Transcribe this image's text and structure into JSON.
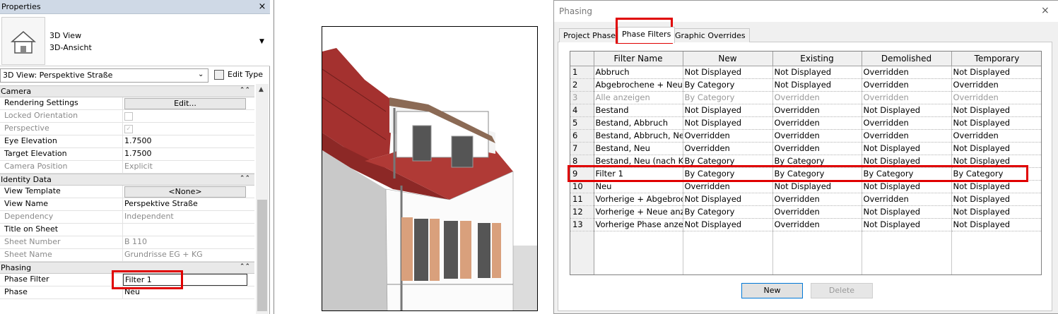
{
  "properties": {
    "title": "Properties",
    "close_icon": "×",
    "type_line1": "3D View",
    "type_line2": "3D-Ansicht",
    "instance_selector": "3D View: Perspektive Straße",
    "edit_type": "Edit Type",
    "groups": [
      {
        "name": "Camera",
        "rows": [
          {
            "name": "Rendering Settings",
            "value": "Edit...",
            "kind": "button"
          },
          {
            "name": "Locked Orientation",
            "value": "",
            "kind": "checkbox",
            "checked": false,
            "disabled": true
          },
          {
            "name": "Perspective",
            "value": "",
            "kind": "checkbox",
            "checked": true,
            "disabled": true
          },
          {
            "name": "Eye Elevation",
            "value": "1.7500"
          },
          {
            "name": "Target Elevation",
            "value": "1.7500"
          },
          {
            "name": "Camera Position",
            "value": "Explicit",
            "disabled": true
          }
        ]
      },
      {
        "name": "Identity Data",
        "rows": [
          {
            "name": "View Template",
            "value": "<None>",
            "kind": "button"
          },
          {
            "name": "View Name",
            "value": "Perspektive Straße"
          },
          {
            "name": "Dependency",
            "value": "Independent",
            "disabled": true
          },
          {
            "name": "Title on Sheet",
            "value": ""
          },
          {
            "name": "Sheet Number",
            "value": "B 110",
            "disabled": true
          },
          {
            "name": "Sheet Name",
            "value": "Grundrisse EG + KG",
            "disabled": true
          }
        ]
      },
      {
        "name": "Phasing",
        "rows": [
          {
            "name": "Phase Filter",
            "value": "Filter 1",
            "kind": "input"
          },
          {
            "name": "Phase",
            "value": "Neu"
          }
        ]
      }
    ]
  },
  "dialog": {
    "title": "Phasing",
    "close_icon": "×",
    "tabs": [
      "Project Phases",
      "Phase Filters",
      "Graphic Overrides"
    ],
    "active_tab": "Phase Filters",
    "columns": [
      "Filter Name",
      "New",
      "Existing",
      "Demolished",
      "Temporary"
    ],
    "rows": [
      {
        "num": "1",
        "name": "Abbruch",
        "new": "Not Displayed",
        "existing": "Not Displayed",
        "demolished": "Overridden",
        "temporary": "Not Displayed"
      },
      {
        "num": "2",
        "name": "Abgebrochene + Neue",
        "new": "By Category",
        "existing": "Not Displayed",
        "demolished": "Overridden",
        "temporary": "Overridden"
      },
      {
        "num": "3",
        "name": "Alle anzeigen",
        "new": "By Category",
        "existing": "Overridden",
        "demolished": "Overridden",
        "temporary": "Overridden",
        "dim": true
      },
      {
        "num": "4",
        "name": "Bestand",
        "new": "Not Displayed",
        "existing": "Overridden",
        "demolished": "Not Displayed",
        "temporary": "Not Displayed"
      },
      {
        "num": "5",
        "name": "Bestand, Abbruch",
        "new": "Not Displayed",
        "existing": "Overridden",
        "demolished": "Overridden",
        "temporary": "Not Displayed"
      },
      {
        "num": "6",
        "name": "Bestand, Abbruch, Neu",
        "new": "Overridden",
        "existing": "Overridden",
        "demolished": "Overridden",
        "temporary": "Overridden"
      },
      {
        "num": "7",
        "name": "Bestand, Neu",
        "new": "Overridden",
        "existing": "Overridden",
        "demolished": "Not Displayed",
        "temporary": "Not Displayed"
      },
      {
        "num": "8",
        "name": "Bestand, Neu (nach Kat",
        "new": "By Category",
        "existing": "By Category",
        "demolished": "Not Displayed",
        "temporary": "Not Displayed"
      },
      {
        "num": "9",
        "name": "Filter 1",
        "new": "By Category",
        "existing": "By Category",
        "demolished": "By Category",
        "temporary": "By Category"
      },
      {
        "num": "10",
        "name": "Neu",
        "new": "Overridden",
        "existing": "Not Displayed",
        "demolished": "Not Displayed",
        "temporary": "Not Displayed"
      },
      {
        "num": "11",
        "name": "Vorherige + Abgebroc",
        "new": "Not Displayed",
        "existing": "Overridden",
        "demolished": "Overridden",
        "temporary": "Not Displayed"
      },
      {
        "num": "12",
        "name": "Vorherige + Neue anzei",
        "new": "By Category",
        "existing": "Overridden",
        "demolished": "Not Displayed",
        "temporary": "Not Displayed"
      },
      {
        "num": "13",
        "name": "Vorherige Phase anzeig",
        "new": "Not Displayed",
        "existing": "Overridden",
        "demolished": "Not Displayed",
        "temporary": "Not Displayed"
      }
    ],
    "buttons": {
      "new": "New",
      "delete": "Delete"
    }
  },
  "colors": {
    "highlight": "#e00000",
    "roof": "#a4312f",
    "shutter": "#d9a07c"
  },
  "icons": [
    "close-icon",
    "house-icon",
    "chevron-down-icon",
    "collapse-chevron-icon",
    "edit-type-icon",
    "checkbox-check-icon"
  ]
}
